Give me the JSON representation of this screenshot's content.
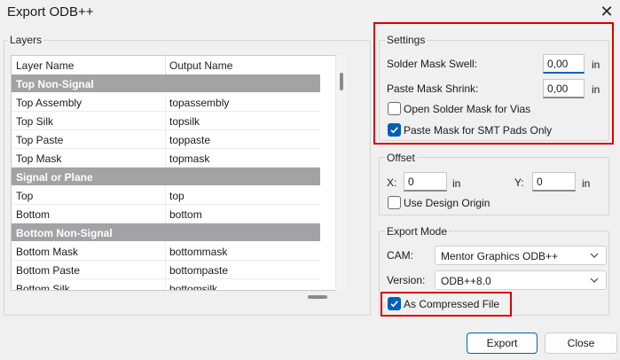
{
  "window": {
    "title": "Export ODB++",
    "close_glyph": "✕"
  },
  "layers": {
    "group_label": "Layers",
    "columns": {
      "layer_name": "Layer Name",
      "output_name": "Output Name"
    },
    "rows": [
      {
        "type": "group",
        "name": "Top Non-Signal",
        "output": ""
      },
      {
        "type": "item",
        "name": "Top Assembly",
        "output": "topassembly"
      },
      {
        "type": "item",
        "name": "Top Silk",
        "output": "topsilk"
      },
      {
        "type": "item",
        "name": "Top Paste",
        "output": "toppaste"
      },
      {
        "type": "item",
        "name": "Top Mask",
        "output": "topmask"
      },
      {
        "type": "group",
        "name": "Signal or Plane",
        "output": ""
      },
      {
        "type": "item",
        "name": "Top",
        "output": "top"
      },
      {
        "type": "item",
        "name": "Bottom",
        "output": "bottom"
      },
      {
        "type": "group",
        "name": "Bottom Non-Signal",
        "output": ""
      },
      {
        "type": "item",
        "name": "Bottom Mask",
        "output": "bottommask"
      },
      {
        "type": "item",
        "name": "Bottom Paste",
        "output": "bottompaste"
      },
      {
        "type": "item",
        "name": "Bottom Silk",
        "output": "bottomsilk"
      }
    ]
  },
  "settings": {
    "group_label": "Settings",
    "solder_mask_swell": {
      "label": "Solder Mask Swell:",
      "value": "0,00",
      "unit": "in"
    },
    "paste_mask_shrink": {
      "label": "Paste Mask Shrink:",
      "value": "0,00",
      "unit": "in"
    },
    "open_solder_mask_for_vias": {
      "label": "Open Solder Mask for Vias",
      "checked": false
    },
    "paste_mask_smt_only": {
      "label": "Paste Mask for SMT Pads Only",
      "checked": true
    }
  },
  "offset": {
    "group_label": "Offset",
    "x": {
      "label": "X:",
      "value": "0",
      "unit": "in"
    },
    "y": {
      "label": "Y:",
      "value": "0",
      "unit": "in"
    },
    "use_design_origin": {
      "label": "Use Design Origin",
      "checked": false
    }
  },
  "export_mode": {
    "group_label": "Export Mode",
    "cam": {
      "label": "CAM:",
      "value": "Mentor Graphics ODB++"
    },
    "version": {
      "label": "Version:",
      "value": "ODB++8.0"
    },
    "as_compressed_file": {
      "label": "As Compressed File",
      "checked": true
    }
  },
  "buttons": {
    "export": "Export",
    "close": "Close"
  },
  "colors": {
    "accent": "#005fb8",
    "highlight_border": "#d90000",
    "group_row": "#a3a3a6"
  }
}
